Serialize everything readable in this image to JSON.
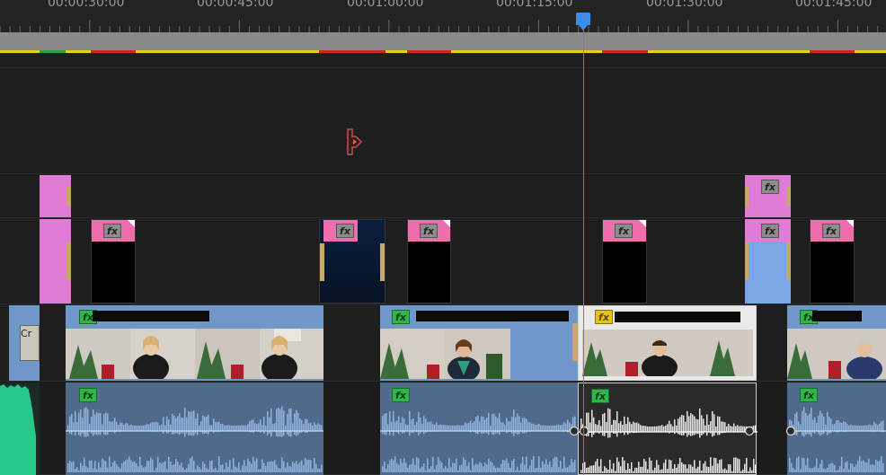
{
  "ruler": {
    "timecodes": [
      "00:00:30:00",
      "00:00:45:00",
      "00:01:00:00",
      "00:01:15:00",
      "00:01:30:00",
      "00:01:45:00"
    ]
  },
  "clips": {
    "fx_label": "fx",
    "v1_clip1_partial_label": "Cr"
  },
  "colors": {
    "background": "#1f1f1f",
    "pink_clip": "#e07bd6",
    "hot_pink_header": "#ef6fae",
    "video_blue": "#6f98c8",
    "audio_blue": "#4f6a8a",
    "playhead": "#3a8ee8",
    "render_yellow": "#e6d21e",
    "render_red": "#c8281e",
    "render_green": "#2ea043",
    "audio_green": "#28c78c"
  }
}
